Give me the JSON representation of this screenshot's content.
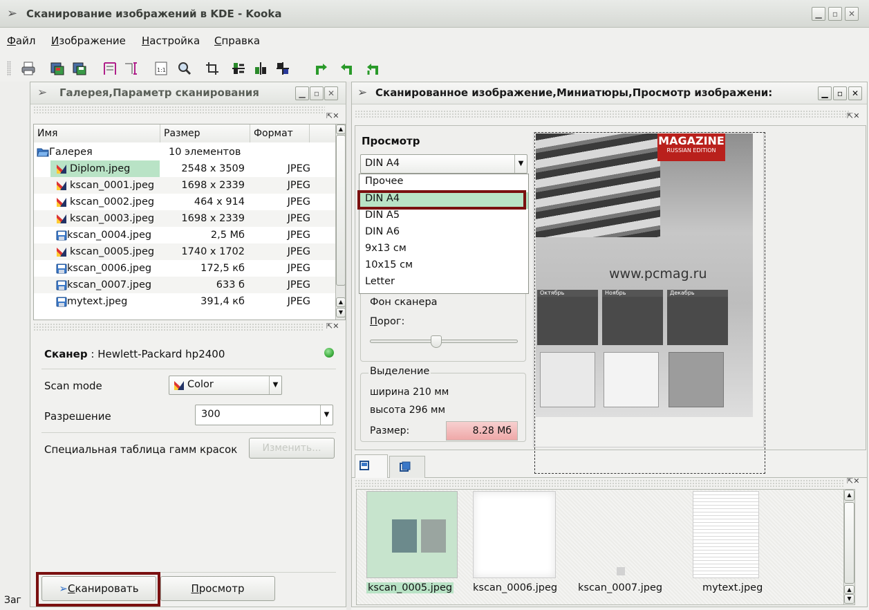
{
  "window": {
    "title": "Сканирование изображений в KDE - Kooka",
    "controls": [
      "minimize",
      "maximize",
      "close"
    ]
  },
  "menubar": {
    "items": [
      {
        "label": "Файл",
        "underline": "Ф",
        "rest": "айл"
      },
      {
        "label": "Изображение",
        "underline": "И",
        "rest": "зображение"
      },
      {
        "label": "Настройка",
        "underline": "Н",
        "rest": "астройка"
      },
      {
        "label": "Справка",
        "underline": "С",
        "rest": "правка"
      }
    ]
  },
  "toolbar": {
    "icons": [
      "print-icon",
      "scan-icon",
      "save-icon",
      "crop-width-icon",
      "crop-height-icon",
      "actual-size-icon",
      "zoom-icon",
      "crop-icon",
      "mirror-vertical-icon",
      "mirror-horizontal-icon",
      "mirror-both-icon",
      "rotate-right-icon",
      "rotate-left-icon",
      "rotate-180-icon"
    ]
  },
  "left_dock": {
    "title": "Галерея,Параметр сканирования",
    "gallery": {
      "columns": [
        "Имя",
        "Размер",
        "Формат"
      ],
      "root": {
        "name": "Галерея",
        "size": "10 элементов"
      },
      "rows": [
        {
          "name": "Diplom.jpeg",
          "size": "2548 x 3509",
          "format": "JPEG",
          "icon": "color-image-icon",
          "selected": true
        },
        {
          "name": "kscan_0001.jpeg",
          "size": "1698 x 2339",
          "format": "JPEG",
          "icon": "color-image-icon"
        },
        {
          "name": "kscan_0002.jpeg",
          "size": "464 x 914",
          "format": "JPEG",
          "icon": "color-image-icon"
        },
        {
          "name": "kscan_0003.jpeg",
          "size": "1698 x 2339",
          "format": "JPEG",
          "icon": "color-image-icon"
        },
        {
          "name": "kscan_0004.jpeg",
          "size": "2,5 Мб",
          "format": "JPEG",
          "icon": "floppy-icon"
        },
        {
          "name": "kscan_0005.jpeg",
          "size": "1740 x 1702",
          "format": "JPEG",
          "icon": "color-image-icon"
        },
        {
          "name": "kscan_0006.jpeg",
          "size": "172,5 кб",
          "format": "JPEG",
          "icon": "floppy-icon"
        },
        {
          "name": "kscan_0007.jpeg",
          "size": "633 б",
          "format": "JPEG",
          "icon": "floppy-icon"
        },
        {
          "name": "mytext.jpeg",
          "size": "391,4 кб",
          "format": "JPEG",
          "icon": "floppy-icon"
        }
      ]
    },
    "scanner": {
      "label": "Сканер",
      "name": ": Hewlett-Packard hp2400",
      "scan_mode_label": "Scan mode",
      "scan_mode_value": "Color",
      "resolution_label": "Разрешение",
      "resolution_value": "300",
      "gamma_label": "Специальная таблица гамм красок",
      "gamma_button": "Изменить..."
    },
    "buttons": {
      "scan": "Сканировать",
      "scan_underline": "С",
      "scan_rest": "канировать",
      "preview": "Просмотр",
      "preview_underline": "П",
      "preview_rest": "росмотр"
    },
    "status_partial": "Заг"
  },
  "right_dock": {
    "title": "Сканированное изображение,Миниатюры,Просмотр изображени:",
    "preview": {
      "heading": "Просмотр",
      "size_select": "DIN A4",
      "size_options": [
        "Прочее",
        "DIN A4",
        "DIN A5",
        "DIN A6",
        "9x13 см",
        "10x15 см",
        "Letter"
      ],
      "highlighted_option": "DIN A4",
      "background_label": "Фон сканера",
      "threshold_label": "Порог:",
      "threshold_underline": "П",
      "threshold_rest": "орог:",
      "threshold_value": 0.45
    },
    "selection": {
      "group_title": "Выделение",
      "width": "ширина 210 мм",
      "height": "высота 296 мм",
      "size_label": "Размер:",
      "size_value": "8.28 Мб"
    },
    "preview_image": {
      "magazine_title": "MAGAZINE",
      "magazine_sub": "RUSSIAN EDITION",
      "url": "www.pcmag.ru",
      "months": [
        "Октябрь",
        "Ноябрь",
        "Декабрь"
      ]
    },
    "thumbnails": [
      {
        "caption": "kscan_0005.jpeg",
        "selected": true
      },
      {
        "caption": "kscan_0006.jpeg"
      },
      {
        "caption": "kscan_0007.jpeg"
      },
      {
        "caption": "mytext.jpeg"
      }
    ]
  },
  "colors": {
    "selection_green": "#b9e3c6",
    "highlight_red_box": "#7a1010",
    "led_green": "#3fae3f",
    "size_warning_bg": "#f0b5b5"
  }
}
